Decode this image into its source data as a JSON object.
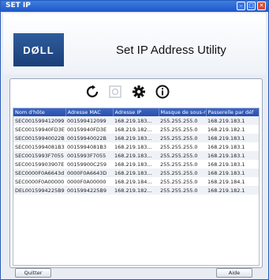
{
  "window": {
    "title": "SET IP",
    "minimize": "–",
    "maximize": "□",
    "close": "✕"
  },
  "header": {
    "logo_text": "DØLL",
    "app_title": "Set IP Address Utility"
  },
  "toolbar": {
    "icons": [
      "refresh-icon",
      "settings-disabled-icon",
      "settings-icon",
      "info-icon"
    ]
  },
  "table": {
    "columns": [
      "Nom d'hôte",
      "Adresse MAC",
      "Adresse IP",
      "Masque de sous-r",
      "Passerelle par déf"
    ],
    "rows": [
      [
        "SEC001599412099",
        "001599412099",
        "168.219.183...",
        "255.255.255.0",
        "168.219.183.1"
      ],
      [
        "SEC00159940FD3E",
        "00159940FD3E",
        "168.219.182...",
        "255.255.255.0",
        "168.219.182.1"
      ],
      [
        "SEC00159940022B",
        "00159940022B",
        "168.219.183...",
        "255.255.255.0",
        "168.219.183.1"
      ],
      [
        "SEC0015994081B3",
        "0015994081B3",
        "168.219.183...",
        "255.255.255.0",
        "168.219.183.1"
      ],
      [
        "SEC0015993F7055",
        "0015993F7055",
        "168.219.183...",
        "255.255.255.0",
        "168.219.183.1"
      ],
      [
        "SEC00159903907E",
        "00159900C259",
        "168.219.183...",
        "255.255.255.0",
        "168.219.183.1"
      ],
      [
        "SEC0000F0A6643d",
        "0000F0A6643D",
        "168.219.183...",
        "255.255.255.0",
        "168.219.183.1"
      ],
      [
        "SEC0000F0A00000",
        "0000F0A00000",
        "168.219.184...",
        "255.255.255.0",
        "168.219.184.1"
      ],
      [
        "DEL0015994225B9",
        "0015994225B9",
        "168.219.182...",
        "255.255.255.0",
        "168.219.182.1"
      ]
    ]
  },
  "buttons": {
    "quit": "Quitter",
    "help": "Aide"
  }
}
